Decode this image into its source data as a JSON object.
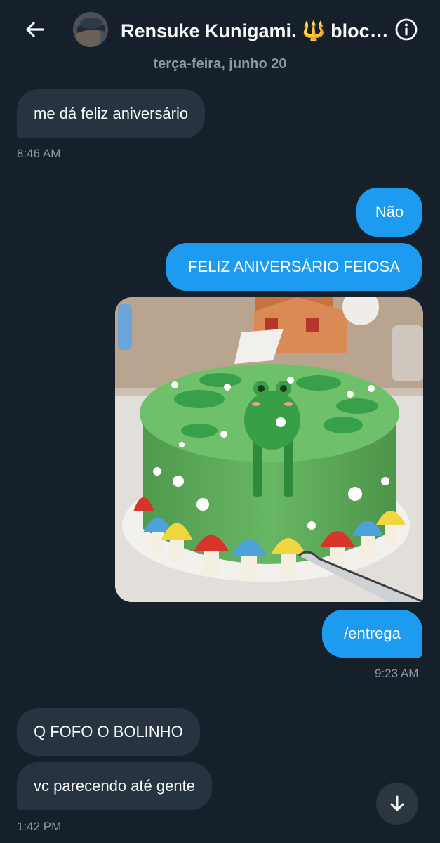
{
  "header": {
    "back_icon": "arrow-left-icon",
    "title": "Rensuke Kunigami. 🔱 block ...",
    "info_icon": "info-circle-icon"
  },
  "date_separator": "terça-feira, junho 20",
  "messages": [
    {
      "direction": "in",
      "text": "me dá feliz aniversário"
    },
    {
      "direction": "out",
      "text": "Não"
    },
    {
      "direction": "out",
      "text": "FELIZ ANIVERSÁRIO FEIOSA"
    },
    {
      "direction": "out",
      "text": "/entrega"
    },
    {
      "direction": "in",
      "text": "Q FOFO O BOLINHO"
    },
    {
      "direction": "in",
      "text": "vc parecendo até gente"
    }
  ],
  "timestamps": [
    "8:46 AM",
    "9:23 AM",
    "1:42 PM"
  ],
  "image_subject": "green frog cake with lily pads, flowers and mushrooms",
  "scroll_icon": "arrow-down-icon",
  "colors": {
    "background": "#15202b",
    "incoming_bubble": "#273340",
    "outgoing_bubble": "#1d9bf0",
    "muted_text": "#8b98a5"
  }
}
